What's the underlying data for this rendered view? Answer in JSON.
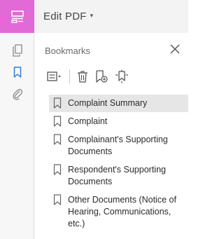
{
  "header": {
    "title": "Edit PDF",
    "caret": "▾"
  },
  "rail": {
    "accent": "#e26ad6"
  },
  "panel": {
    "title": "Bookmarks"
  },
  "bookmarks": [
    {
      "label": "Complaint Summary",
      "selected": true
    },
    {
      "label": "Complaint",
      "selected": false
    },
    {
      "label": "Complainant's Supporting Documents",
      "selected": false
    },
    {
      "label": "Respondent's Supporting Documents",
      "selected": false
    },
    {
      "label": "Other Documents (Notice of Hearing, Communications, etc.)",
      "selected": false
    }
  ]
}
